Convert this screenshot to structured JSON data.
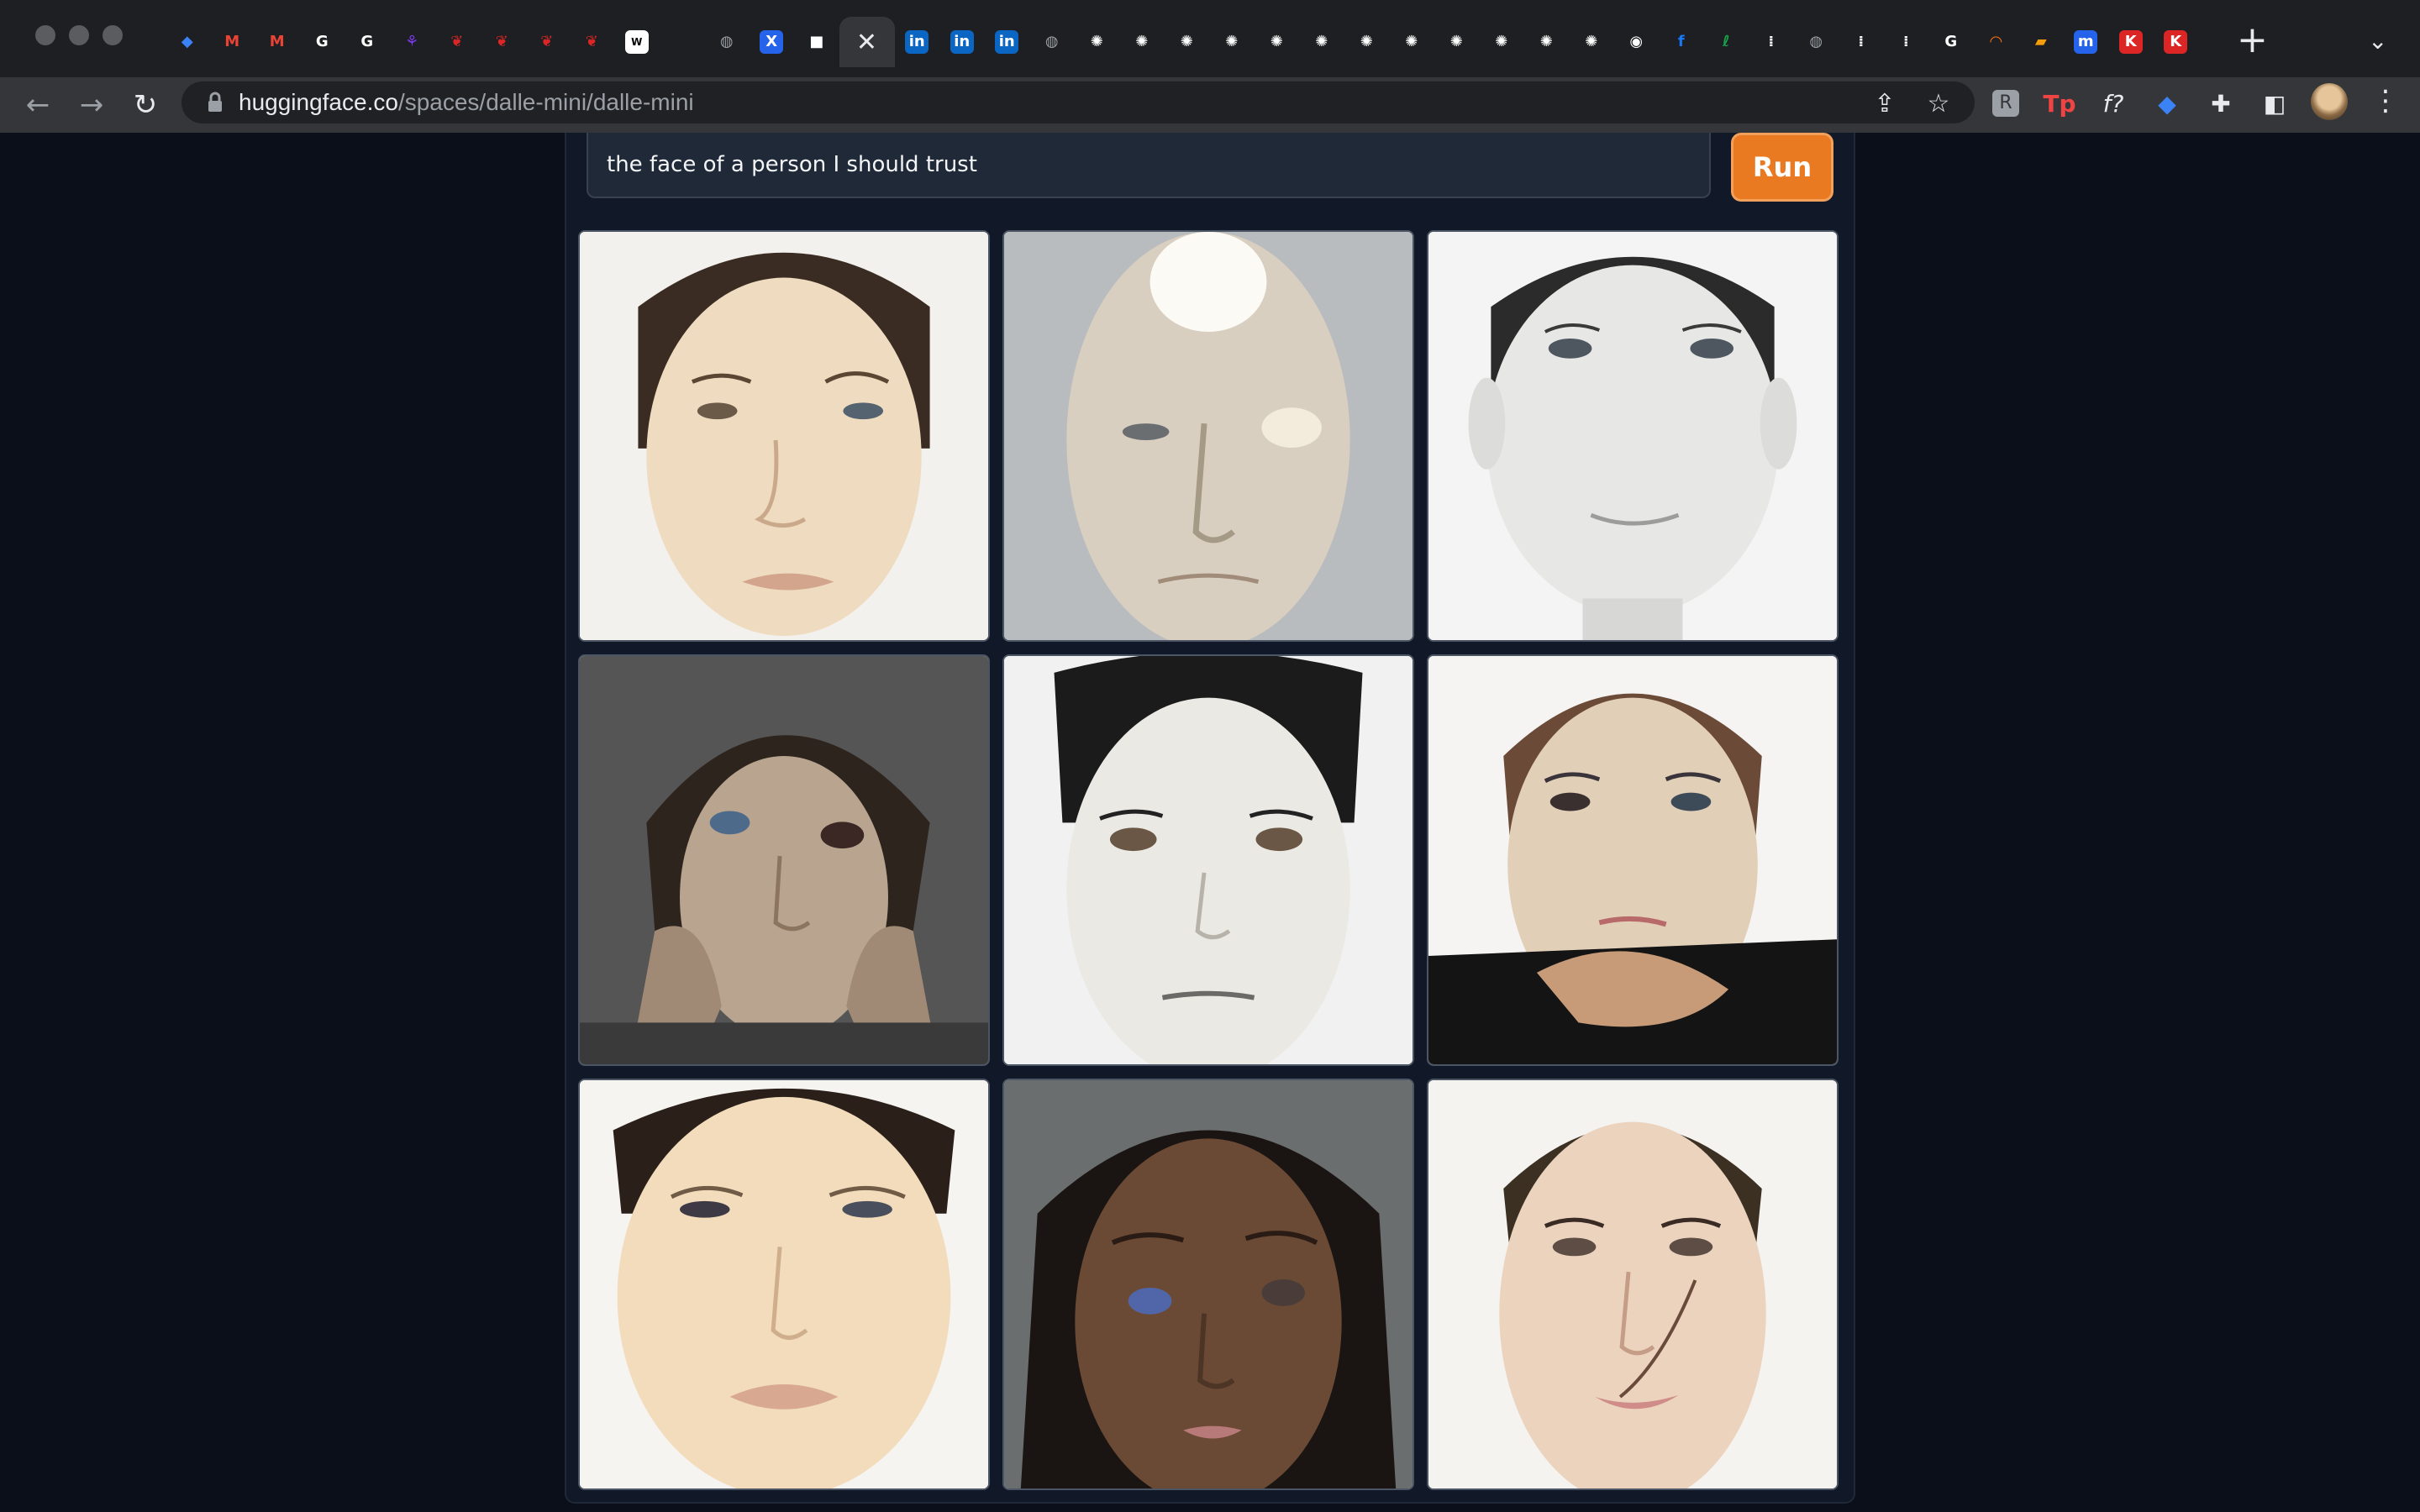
{
  "browser": {
    "url_host": "huggingface.co",
    "url_path": "/spaces/dalle-mini/dalle-mini",
    "tabs": [
      {
        "icon": "diamond-icon",
        "color": "#3b82f6",
        "glyph": "◆"
      },
      {
        "icon": "gmail-icon",
        "color": "#ea4335",
        "glyph": "M"
      },
      {
        "icon": "gmail-icon",
        "color": "#ea4335",
        "glyph": "M"
      },
      {
        "icon": "google-icon",
        "color": "#ffffff",
        "glyph": "G"
      },
      {
        "icon": "google-icon",
        "color": "#ffffff",
        "glyph": "G"
      },
      {
        "icon": "purple-app-icon",
        "color": "#7c3aed",
        "glyph": "⚘"
      },
      {
        "icon": "red-pin-icon",
        "color": "#dc2626",
        "glyph": "❦"
      },
      {
        "icon": "red-pin-icon",
        "color": "#dc2626",
        "glyph": "❦"
      },
      {
        "icon": "red-pin-icon",
        "color": "#dc2626",
        "glyph": "❦"
      },
      {
        "icon": "red-pin-icon",
        "color": "#dc2626",
        "glyph": "❦"
      },
      {
        "icon": "wix-icon",
        "color": "#ffffff",
        "glyph": "W"
      },
      {
        "icon": "blank-icon",
        "color": "#1e1f22",
        "glyph": ""
      },
      {
        "icon": "globe-icon",
        "color": "#9aa0a6",
        "glyph": "◍"
      },
      {
        "icon": "xra-icon",
        "color": "#2563eb",
        "glyph": "X"
      },
      {
        "icon": "white-square-icon",
        "color": "#ffffff",
        "glyph": "■"
      },
      {
        "icon": "close-icon",
        "color": "#e8eaed",
        "glyph": "✕",
        "active": true
      },
      {
        "icon": "linkedin-icon",
        "color": "#0a66c2",
        "glyph": "in"
      },
      {
        "icon": "linkedin-icon",
        "color": "#0a66c2",
        "glyph": "in"
      },
      {
        "icon": "linkedin-icon",
        "color": "#0a66c2",
        "glyph": "in"
      },
      {
        "icon": "globe-icon",
        "color": "#9aa0a6",
        "glyph": "◍"
      },
      {
        "icon": "gear-icon",
        "color": "#ffffff",
        "glyph": "✺"
      },
      {
        "icon": "gear-icon",
        "color": "#ffffff",
        "glyph": "✺"
      },
      {
        "icon": "gear-icon",
        "color": "#ffffff",
        "glyph": "✺"
      },
      {
        "icon": "gear-icon",
        "color": "#ffffff",
        "glyph": "✺"
      },
      {
        "icon": "gear-icon",
        "color": "#ffffff",
        "glyph": "✺"
      },
      {
        "icon": "gear-icon",
        "color": "#ffffff",
        "glyph": "✺"
      },
      {
        "icon": "gear-icon",
        "color": "#ffffff",
        "glyph": "✺"
      },
      {
        "icon": "gear-icon",
        "color": "#ffffff",
        "glyph": "✺"
      },
      {
        "icon": "gear-icon",
        "color": "#ffffff",
        "glyph": "✺"
      },
      {
        "icon": "gear-icon",
        "color": "#ffffff",
        "glyph": "✺"
      },
      {
        "icon": "gear-icon",
        "color": "#ffffff",
        "glyph": "✺"
      },
      {
        "icon": "gear-icon",
        "color": "#ffffff",
        "glyph": "✺"
      },
      {
        "icon": "github-icon",
        "color": "#ffffff",
        "glyph": "◉"
      },
      {
        "icon": "facebook-icon",
        "color": "#1877f2",
        "glyph": "f"
      },
      {
        "icon": "green-app-icon",
        "color": "#16a34a",
        "glyph": "ℓ"
      },
      {
        "icon": "dots-app-icon",
        "color": "#ffffff",
        "glyph": "⁞"
      },
      {
        "icon": "globe-icon",
        "color": "#9aa0a6",
        "glyph": "◍"
      },
      {
        "icon": "dots-app-icon",
        "color": "#ffffff",
        "glyph": "⁞"
      },
      {
        "icon": "dots-app-icon",
        "color": "#ffffff",
        "glyph": "⁞"
      },
      {
        "icon": "google-icon",
        "color": "#ffffff",
        "glyph": "G"
      },
      {
        "icon": "orange-arc-icon",
        "color": "#f97316",
        "glyph": "◠"
      },
      {
        "icon": "book-icon",
        "color": "#f59e0b",
        "glyph": "▰"
      },
      {
        "icon": "m-app-icon",
        "color": "#2563eb",
        "glyph": "m"
      },
      {
        "icon": "k-app-icon",
        "color": "#dc2626",
        "glyph": "K"
      },
      {
        "icon": "k-app-icon",
        "color": "#dc2626",
        "glyph": "K"
      }
    ]
  },
  "prompt": {
    "value": "the face of a person I should trust"
  },
  "run_label": "Run",
  "gallery": {
    "images": [
      {
        "desc": "face-1"
      },
      {
        "desc": "face-2"
      },
      {
        "desc": "face-3"
      },
      {
        "desc": "face-4"
      },
      {
        "desc": "face-5"
      },
      {
        "desc": "face-6"
      },
      {
        "desc": "face-7"
      },
      {
        "desc": "face-8"
      },
      {
        "desc": "face-9"
      }
    ]
  },
  "colors": {
    "page_bg": "#0b0f19",
    "panel_bg": "#111827",
    "run_button": "#ea7a22"
  }
}
